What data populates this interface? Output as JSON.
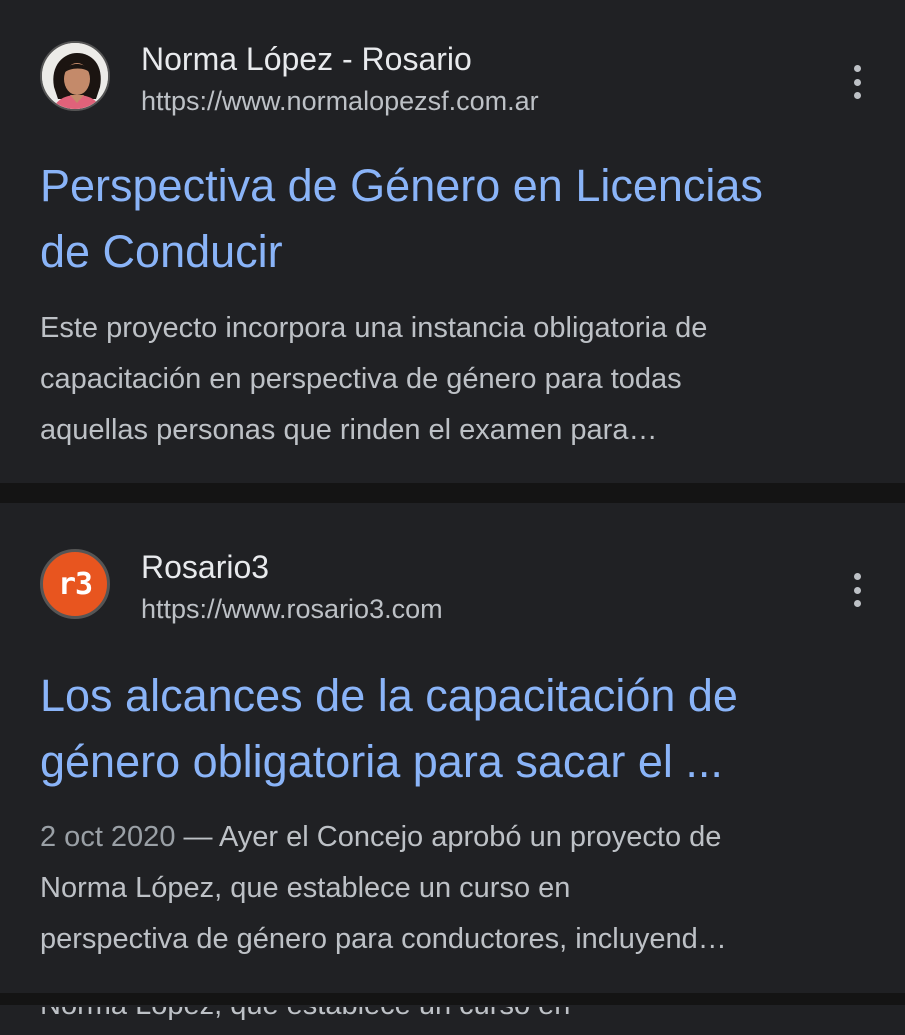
{
  "results": [
    {
      "site_name": "Norma López - Rosario",
      "url": "https://www.normalopezsf.com.ar",
      "favicon": "person-avatar-icon",
      "title_lines": [
        "Perspectiva de Género en Licencias",
        "de Conducir"
      ],
      "snippet_lines": [
        "Este proyecto incorpora una instancia obligatoria de",
        "capacitación en perspectiva de género para todas",
        "aquellas personas que rinden el examen para…"
      ]
    },
    {
      "site_name": "Rosario3",
      "url": "https://www.rosario3.com",
      "favicon": "r3-logo-icon",
      "favicon_text": "r3",
      "title_lines": [
        "Los alcances de la capacitación de",
        "género obligatoria para sacar el ..."
      ],
      "date": "2 oct 2020",
      "snippet_lines": [
        " — Ayer el Concejo aprobó un proyecto de",
        "Norma López, que establece un curso en",
        "perspectiva de género para conductores, incluyend…"
      ]
    }
  ],
  "partial_next_text": "Norma López, que establece un curso en",
  "colors": {
    "background": "#141414",
    "card": "#202124",
    "title_link": "#8ab4f8",
    "text": "#bdc1c6",
    "r3_brand": "#e8551f"
  }
}
